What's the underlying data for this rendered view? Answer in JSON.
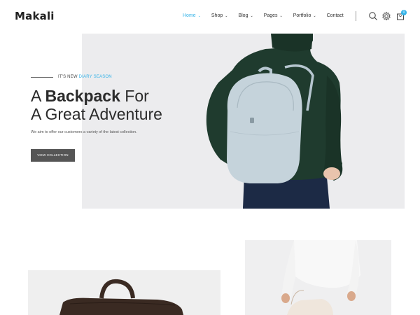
{
  "brand": {
    "logo_text": "Makali"
  },
  "nav": {
    "items": [
      {
        "label": "Home",
        "active": true,
        "has_dropdown": true
      },
      {
        "label": "Shop",
        "active": false,
        "has_dropdown": true
      },
      {
        "label": "Blog",
        "active": false,
        "has_dropdown": true
      },
      {
        "label": "Pages",
        "active": false,
        "has_dropdown": true
      },
      {
        "label": "Portfolio",
        "active": false,
        "has_dropdown": true
      },
      {
        "label": "Contact",
        "active": false,
        "has_dropdown": false
      }
    ],
    "cart_count": "0",
    "icons": [
      "search-icon",
      "gear-icon",
      "cart-icon"
    ]
  },
  "hero": {
    "eyebrow_prefix": "IT'S NEW ",
    "eyebrow_highlight": "DIARY SEASON",
    "title_line1_pre": "A ",
    "title_line1_bold": "Backpack",
    "title_line1_post": " For",
    "title_line2": "A Great Adventure",
    "description": "We aim to offer our customers a variety of the latest collection.",
    "cta_label": "VIEW COLLECTION"
  },
  "colors": {
    "accent": "#35b3e8",
    "hero_bg": "#ececee",
    "button_bg": "#555555",
    "sweater": "#1f3b2e",
    "bag": "#c5d3db"
  }
}
